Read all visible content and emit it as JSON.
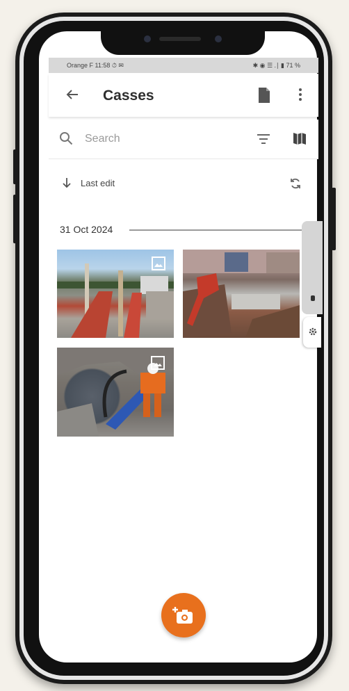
{
  "status_bar": {
    "carrier_time": "Orange F 11:58 ⏱ ✉",
    "right": "✱ ◉ ☰ .∣ ▮ 71 %"
  },
  "app_bar": {
    "title": "Casses",
    "back_icon": "arrow-left-icon",
    "doc_icon": "document-icon",
    "more_icon": "more-vertical-icon"
  },
  "search": {
    "placeholder": "Search",
    "filter_icon": "filter-icon",
    "map_icon": "map-icon"
  },
  "sort": {
    "label": "Last edit",
    "direction_icon": "arrow-down-icon",
    "sync_icon": "sync-icon"
  },
  "groups": [
    {
      "date": "31 Oct 2024",
      "photos": [
        {
          "subject": "trench along road with red barriers",
          "badge": "image-icon"
        },
        {
          "subject": "excavation with red excavator arm"
        },
        {
          "subject": "worker in orange gear with blue pipe",
          "badge": "image-icon"
        }
      ]
    }
  ],
  "fab": {
    "icon": "add-photo-icon"
  },
  "colors": {
    "accent": "#e8701d",
    "app_bar": "#ffffff",
    "status_bar": "#d8d8d8"
  }
}
